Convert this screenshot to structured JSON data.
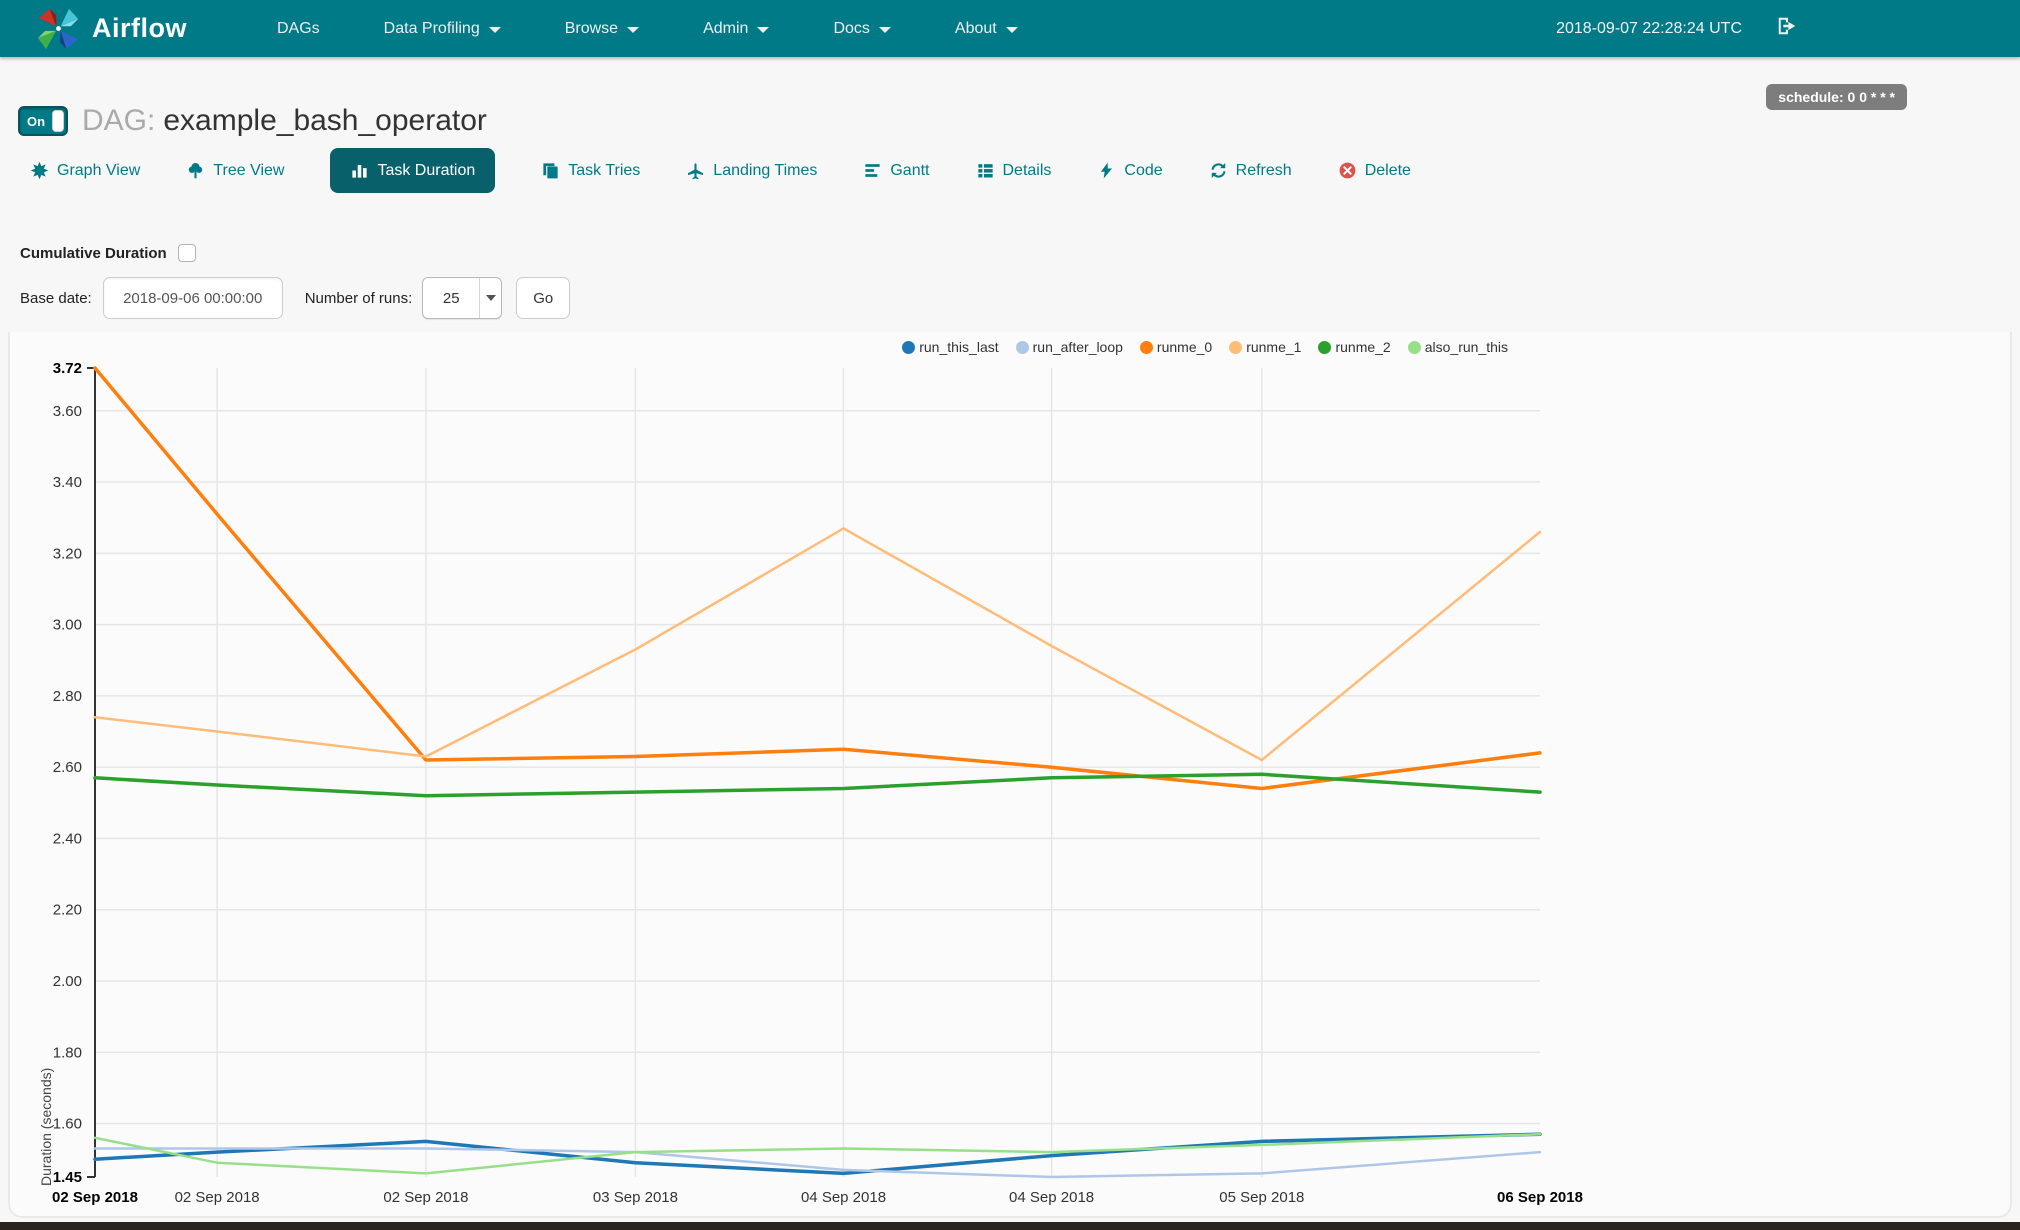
{
  "navbar": {
    "brand": "Airflow",
    "items": [
      {
        "label": "DAGs",
        "caret": false
      },
      {
        "label": "Data Profiling",
        "caret": true
      },
      {
        "label": "Browse",
        "caret": true
      },
      {
        "label": "Admin",
        "caret": true
      },
      {
        "label": "Docs",
        "caret": true
      },
      {
        "label": "About",
        "caret": true
      }
    ],
    "clock": "2018-09-07 22:28:24 UTC"
  },
  "header": {
    "toggle_label": "On",
    "dag_prefix": "DAG:",
    "dag_name": "example_bash_operator",
    "schedule_badge": "schedule: 0 0 * * *"
  },
  "tabs": [
    {
      "label": "Graph View",
      "icon": "burst-icon",
      "active": false
    },
    {
      "label": "Tree View",
      "icon": "tree-icon",
      "active": false
    },
    {
      "label": "Task Duration",
      "icon": "bar-chart-icon",
      "active": true
    },
    {
      "label": "Task Tries",
      "icon": "duplicate-icon",
      "active": false
    },
    {
      "label": "Landing Times",
      "icon": "plane-icon",
      "active": false
    },
    {
      "label": "Gantt",
      "icon": "align-left-icon",
      "active": false
    },
    {
      "label": "Details",
      "icon": "list-icon",
      "active": false
    },
    {
      "label": "Code",
      "icon": "bolt-icon",
      "active": false
    },
    {
      "label": "Refresh",
      "icon": "refresh-icon",
      "active": false
    },
    {
      "label": "Delete",
      "icon": "delete-icon",
      "active": false,
      "danger": true
    }
  ],
  "controls": {
    "cumulative_label": "Cumulative Duration",
    "checkbox_checked": false,
    "base_date_label": "Base date:",
    "base_date_value": "2018-09-06 00:00:00",
    "num_runs_label": "Number of runs:",
    "num_runs_value": "25",
    "go_label": "Go"
  },
  "colors": {
    "accent_teal": "#007A87",
    "active_tab": "#07606a",
    "badge_gray": "#7d7d7d",
    "delete_red": "#d9534f"
  },
  "chart_data": {
    "type": "line",
    "title": "",
    "xlabel": "",
    "ylabel": "Duration (seconds)",
    "ylim": [
      1.45,
      3.72
    ],
    "grid": true,
    "legend_position": "top-right",
    "y_ticks": [
      "1.45",
      "1.60",
      "1.80",
      "2.00",
      "2.20",
      "2.40",
      "2.60",
      "2.80",
      "3.00",
      "3.20",
      "3.40",
      "3.60",
      "3.72"
    ],
    "y_bold_ticks": [
      "1.45",
      "3.72"
    ],
    "categories": [
      "02 Sep 2018",
      "02 Sep 2018",
      "02 Sep 2018",
      "03 Sep 2018",
      "04 Sep 2018",
      "04 Sep 2018",
      "05 Sep 2018",
      "06 Sep 2018"
    ],
    "x_fractions": [
      0,
      0.0845,
      0.229,
      0.374,
      0.518,
      0.662,
      0.8075,
      1
    ],
    "x_bold_indices": [
      0,
      7
    ],
    "series": [
      {
        "name": "run_this_last",
        "color": "#1f77b4",
        "values": [
          1.5,
          1.52,
          1.55,
          1.49,
          1.46,
          1.51,
          1.55,
          1.57
        ]
      },
      {
        "name": "run_after_loop",
        "color": "#aec7e8",
        "values": [
          1.53,
          1.53,
          1.53,
          1.52,
          1.47,
          1.45,
          1.46,
          1.52
        ]
      },
      {
        "name": "runme_0",
        "color": "#ff7f0e",
        "values": [
          3.72,
          3.31,
          2.62,
          2.63,
          2.65,
          2.6,
          2.54,
          2.64
        ]
      },
      {
        "name": "runme_1",
        "color": "#ffbb78",
        "values": [
          2.74,
          2.7,
          2.63,
          2.93,
          3.27,
          2.94,
          2.62,
          3.26
        ]
      },
      {
        "name": "runme_2",
        "color": "#2ca02c",
        "values": [
          2.57,
          2.55,
          2.52,
          2.53,
          2.54,
          2.57,
          2.58,
          2.53
        ]
      },
      {
        "name": "also_run_this",
        "color": "#98df8a",
        "values": [
          1.56,
          1.49,
          1.46,
          1.52,
          1.53,
          1.52,
          1.54,
          1.57
        ]
      }
    ]
  }
}
